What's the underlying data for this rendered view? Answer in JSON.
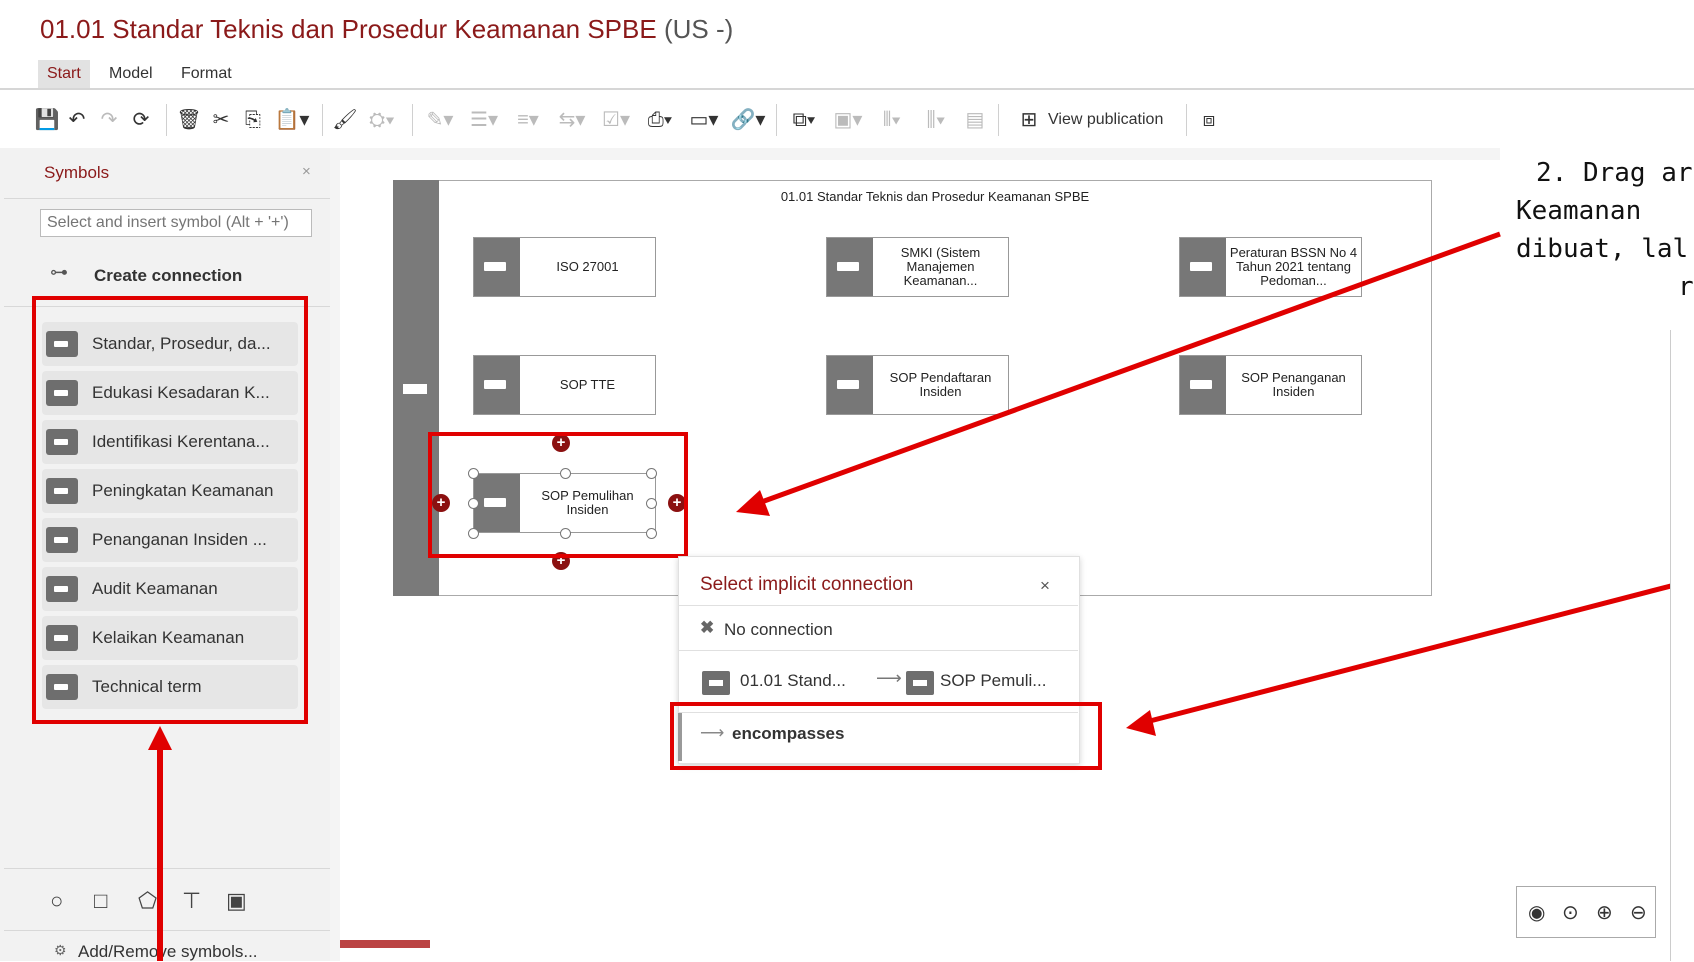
{
  "header": {
    "title": "01.01 Standar Teknis dan Prosedur Keamanan SPBE",
    "lang": "(US -)"
  },
  "menu": {
    "tabs": [
      "Start",
      "Model",
      "Format"
    ],
    "active": "Start"
  },
  "toolbar": {
    "view_publication": "View publication"
  },
  "symbols_panel": {
    "title": "Symbols",
    "close": "×",
    "search_placeholder": "Select and insert symbol (Alt + '+')",
    "create_connection": "Create connection",
    "items": [
      "Standar, Prosedur, da...",
      "Edukasi Kesadaran K...",
      "Identifikasi Kerentana...",
      "Peningkatan Keamanan",
      "Penanganan Insiden ...",
      "Audit Keamanan",
      "Kelaikan Keamanan",
      "Technical term"
    ],
    "add_remove": "Add/Remove symbols..."
  },
  "canvas": {
    "pool_title": "01.01 Standar Teknis dan Prosedur Keamanan SPBE",
    "objects": [
      "ISO 27001",
      "SMKI (Sistem Manajemen Keamanan...",
      "Peraturan BSSN No 4 Tahun 2021 tentang Pedoman...",
      "SOP TTE",
      "SOP Pendaftaran Insiden",
      "SOP Penanganan Insiden",
      "SOP Pemulihan Insiden"
    ]
  },
  "popup": {
    "title": "Select implicit connection",
    "close": "×",
    "no_connection": "No connection",
    "from": "01.01 Stand...",
    "to": "SOP Pemuli...",
    "connection_type": "encompasses"
  },
  "annotation": {
    "line1": "2. Drag ar",
    "line2": "Keamanan",
    "line3": "dibuat, lal",
    "line4": "r",
    "color": "#e00000"
  },
  "icons": {
    "save": "save-icon",
    "undo": "undo-icon",
    "redo": "redo-icon",
    "refresh": "refresh-icon",
    "delete": "delete-icon",
    "cut": "cut-icon",
    "copy": "copy-icon",
    "paste": "paste-icon",
    "zoom_eye": "eye-icon",
    "zoom_100": "zoom-100-icon",
    "zoom_in": "zoom-in-icon",
    "zoom_out": "zoom-out-icon"
  }
}
